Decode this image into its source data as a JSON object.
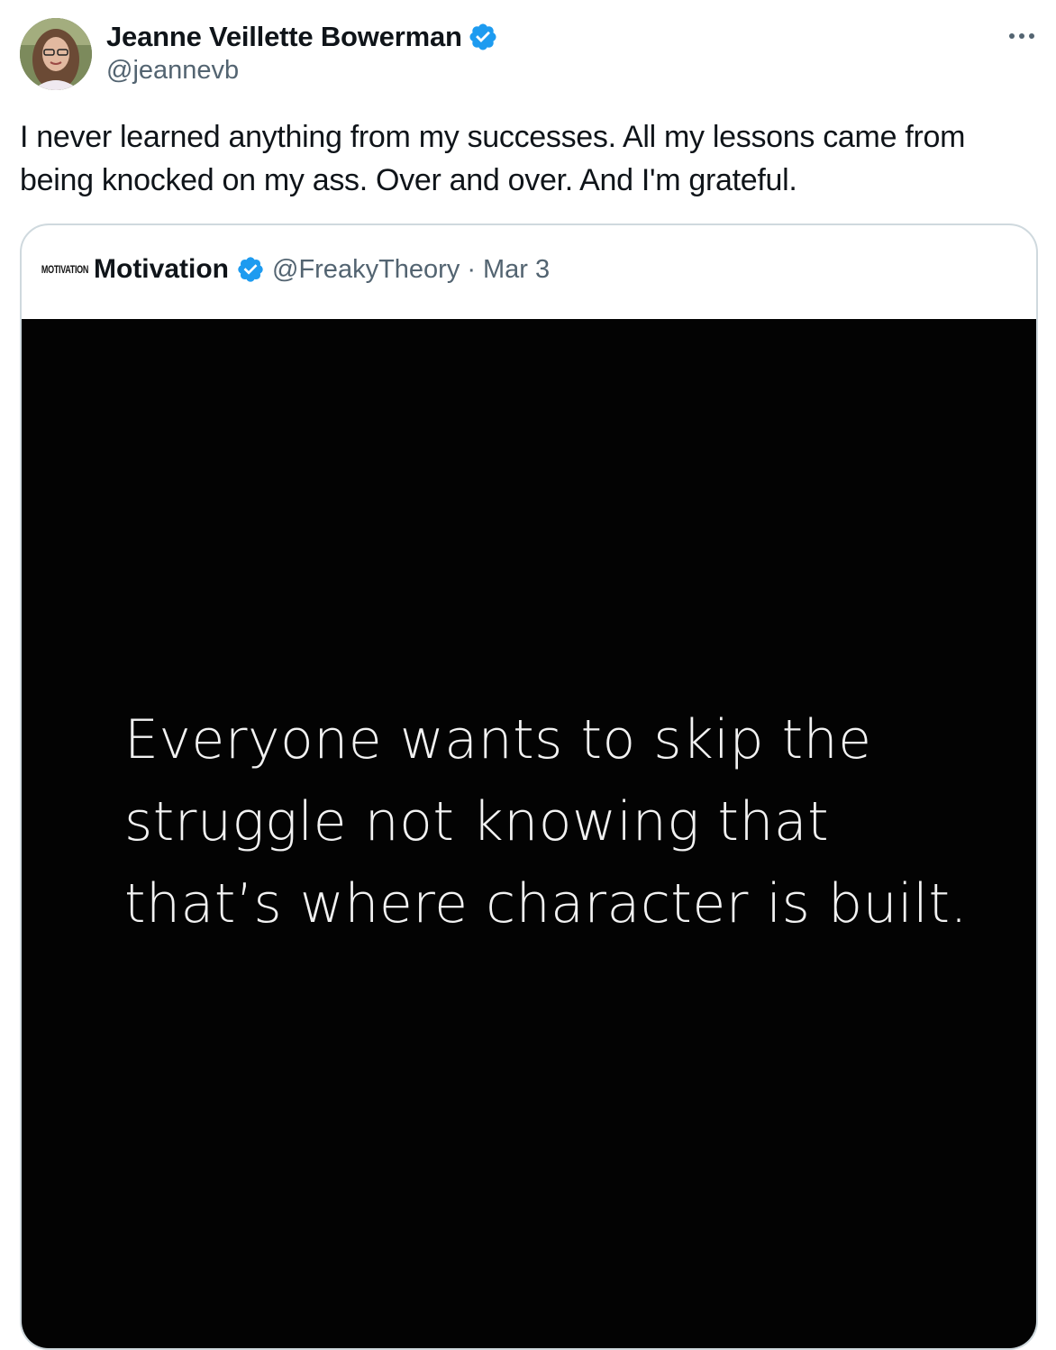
{
  "tweet": {
    "author": {
      "display_name": "Jeanne Veillette Bowerman",
      "handle": "@jeannevb",
      "verified_icon": "verified-badge-icon",
      "avatar": "profile-photo"
    },
    "more_icon": "more-options-icon",
    "text": "I never learned anything from my successes. All my lessons came from\nbeing knocked on my ass. Over and over. And I'm grateful."
  },
  "quoted_tweet": {
    "logo_text": "MOTIVATION",
    "display_name": "Motivation",
    "handle": "@FreakyTheory",
    "separator": "·",
    "date": "Mar 3",
    "image_text": "Everyone wants to skip the\nstruggle not knowing that\nthat’s where character is built."
  },
  "colors": {
    "text_primary": "#0f1419",
    "text_secondary": "#536471",
    "verified_blue": "#1d9bf0",
    "border": "#cfd9de",
    "image_bg": "#030303"
  }
}
